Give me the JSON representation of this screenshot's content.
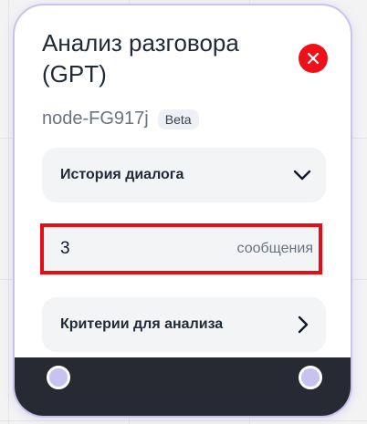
{
  "node": {
    "title": "Анализ разговора (GPT)",
    "id": "node-FG917j",
    "badge": "Beta"
  },
  "history": {
    "label": "История диалога",
    "icon": "chevron-down-icon"
  },
  "messages": {
    "value": "3",
    "unit": "сообщения"
  },
  "criteria": {
    "label": "Критерии для анализа",
    "icon": "chevron-right-icon"
  },
  "colors": {
    "close": "#f1101a",
    "highlight": "#e60d14",
    "footer": "#272a33",
    "handle": "#c7c2f0",
    "card_border": "#c9c2ef"
  }
}
